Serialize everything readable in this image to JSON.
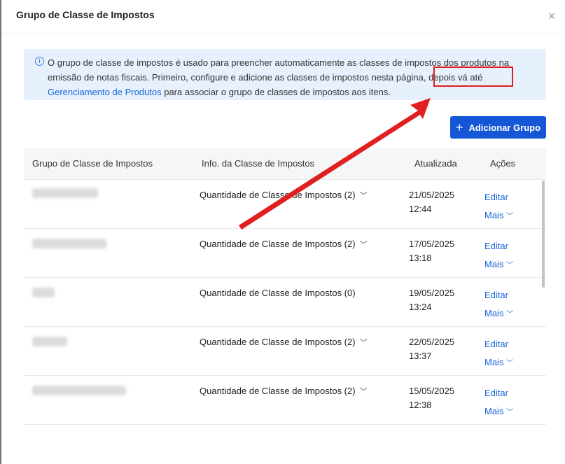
{
  "modal": {
    "title": "Grupo de Classe de Impostos",
    "close_symbol": "×"
  },
  "info": {
    "icon": "info-icon",
    "text_before": "O grupo de classe de impostos é usado para preencher automaticamente as classes de impostos dos produtos na emissão de notas fiscais. Primeiro, configure e adicione as classes de impostos nesta página, depois vá até ",
    "link_text": "Gerenciamento de Produtos",
    "text_after": " para associar o grupo de classes de impostos aos itens."
  },
  "toolbar": {
    "add_group_label": "Adicionar Grupo",
    "add_group_icon": "plus-icon"
  },
  "table": {
    "headers": {
      "group": "Grupo de Classe de Impostos",
      "info": "Info. da Classe de Impostos",
      "updated": "Atualizada",
      "actions": "Ações"
    },
    "rows": [
      {
        "qty": "Quantidade de Classe de Impostos (2)",
        "has_chevron": true,
        "date": "21/05/2025",
        "time": "12:44",
        "edit": "Editar",
        "more": "Mais"
      },
      {
        "qty": "Quantidade de Classe de Impostos (2)",
        "has_chevron": true,
        "date": "17/05/2025",
        "time": "13:18",
        "edit": "Editar",
        "more": "Mais"
      },
      {
        "qty": "Quantidade de Classe de Impostos (0)",
        "has_chevron": false,
        "date": "19/05/2025",
        "time": "13:24",
        "edit": "Editar",
        "more": "Mais"
      },
      {
        "qty": "Quantidade de Classe de Impostos (2)",
        "has_chevron": true,
        "date": "22/05/2025",
        "time": "13:37",
        "edit": "Editar",
        "more": "Mais"
      },
      {
        "qty": "Quantidade de Classe de Impostos (2)",
        "has_chevron": true,
        "date": "15/05/2025",
        "time": "12:38",
        "edit": "Editar",
        "more": "Mais"
      }
    ]
  },
  "annotation": {
    "color": "#e02020"
  }
}
